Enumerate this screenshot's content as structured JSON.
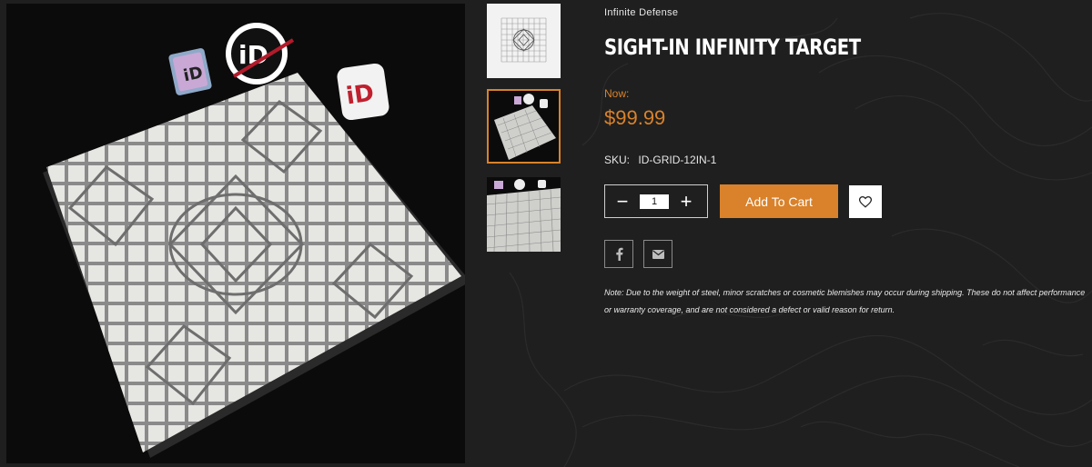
{
  "product": {
    "brand": "Infinite Defense",
    "title": "SIGHT-IN INFINITY TARGET",
    "price_label": "Now:",
    "price": "$99.99",
    "sku_label": "SKU:",
    "sku_value": "ID-GRID-12IN-1",
    "note": "Note: Due to the weight of steel, minor scratches or cosmetic blemishes may occur during shipping. These do not affect performance or warranty coverage, and are not considered a defect or valid reason for return."
  },
  "quantity": {
    "decrement_symbol": "−",
    "value": "1",
    "increment_symbol": "+"
  },
  "buttons": {
    "add_to_cart": "Add To Cart"
  },
  "icons": {
    "wishlist": "heart-icon",
    "share_facebook": "facebook-icon",
    "share_email": "email-icon"
  },
  "sticker_text": {
    "sticker_1": "iD",
    "sticker_2": "iD",
    "sticker_3": "iD"
  },
  "colors": {
    "accent": "#d9822b",
    "background": "#1f1f1f",
    "text": "#ffffff"
  },
  "thumbnails": {
    "selected_index": 1
  }
}
